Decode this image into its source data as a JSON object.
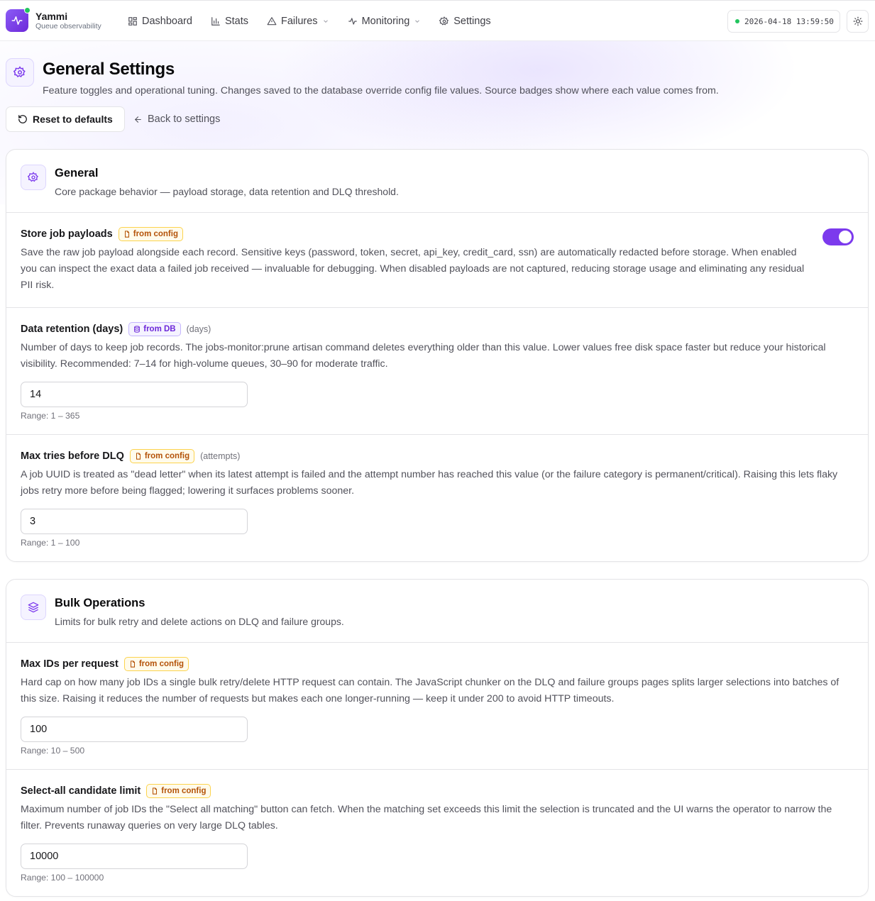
{
  "brand": {
    "name": "Yammi",
    "subtitle": "Queue observability"
  },
  "nav": [
    {
      "label": "Dashboard",
      "icon": "dashboard-icon"
    },
    {
      "label": "Stats",
      "icon": "bar-chart-icon"
    },
    {
      "label": "Failures",
      "icon": "warning-icon",
      "dropdown": true
    },
    {
      "label": "Monitoring",
      "icon": "activity-icon",
      "dropdown": true
    },
    {
      "label": "Settings",
      "icon": "gear-icon"
    }
  ],
  "clock": "2026-04-18 13:59:50",
  "page": {
    "title": "General Settings",
    "description": "Feature toggles and operational tuning. Changes saved to the database override config file values. Source badges show where each value comes from.",
    "reset_label": "Reset to defaults",
    "back_label": "Back to settings"
  },
  "cards": [
    {
      "title": "General",
      "description": "Core package behavior — payload storage, data retention and DLQ threshold.",
      "rows": [
        {
          "name": "Store job payloads",
          "badge": "from config",
          "badge_type": "config",
          "description": "Save the raw job payload alongside each record. Sensitive keys (password, token, secret, api_key, credit_card, ssn) are automatically redacted before storage. When enabled you can inspect the exact data a failed job received — invaluable for debugging. When disabled payloads are not captured, reducing storage usage and eliminating any residual PII risk.",
          "toggle": true
        },
        {
          "name": "Data retention (days)",
          "badge": "from DB",
          "badge_type": "db",
          "unit": "(days)",
          "description": "Number of days to keep job records. The jobs-monitor:prune artisan command deletes everything older than this value. Lower values free disk space faster but reduce your historical visibility. Recommended: 7–14 for high-volume queues, 30–90 for moderate traffic.",
          "value": "14",
          "range": "Range: 1 – 365"
        },
        {
          "name": "Max tries before DLQ",
          "badge": "from config",
          "badge_type": "config",
          "unit": "(attempts)",
          "description": "A job UUID is treated as \"dead letter\" when its latest attempt is failed and the attempt number has reached this value (or the failure category is permanent/critical). Raising this lets flaky jobs retry more before being flagged; lowering it surfaces problems sooner.",
          "value": "3",
          "range": "Range: 1 – 100"
        }
      ]
    },
    {
      "title": "Bulk Operations",
      "description": "Limits for bulk retry and delete actions on DLQ and failure groups.",
      "rows": [
        {
          "name": "Max IDs per request",
          "badge": "from config",
          "badge_type": "config",
          "description": "Hard cap on how many job IDs a single bulk retry/delete HTTP request can contain. The JavaScript chunker on the DLQ and failure groups pages splits larger selections into batches of this size. Raising it reduces the number of requests but makes each one longer-running — keep it under 200 to avoid HTTP timeouts.",
          "value": "100",
          "range": "Range: 10 – 500"
        },
        {
          "name": "Select-all candidate limit",
          "badge": "from config",
          "badge_type": "config",
          "description": "Maximum number of job IDs the \"Select all matching\" button can fetch. When the matching set exceeds this limit the selection is truncated and the UI warns the operator to narrow the filter. Prevents runaway queries on very large DLQ tables.",
          "value": "10000",
          "range": "Range: 100 – 100000"
        }
      ]
    }
  ],
  "colors": {
    "accent": "#7c3aed",
    "config_badge": "#b45309",
    "db_badge": "#6d28d9",
    "status_dot": "#22c55e"
  }
}
